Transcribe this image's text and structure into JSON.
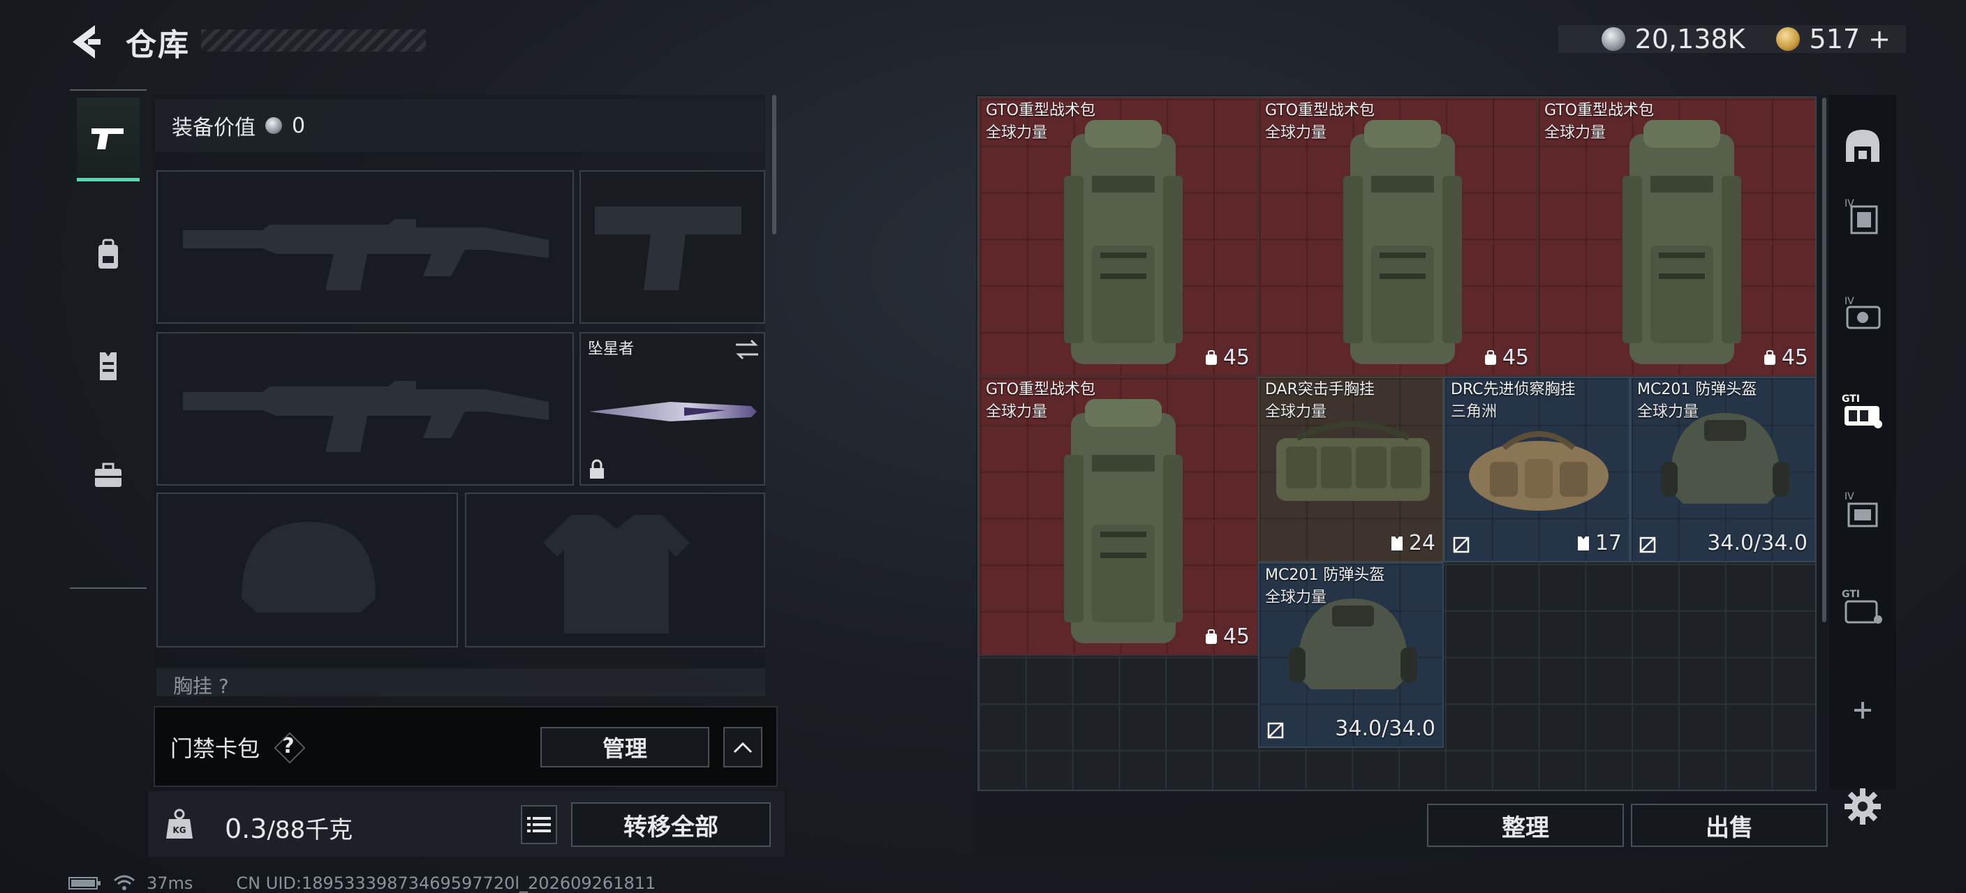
{
  "header": {
    "title": "仓库",
    "currency": [
      {
        "icon": "silver-coin-icon",
        "value": "20,138K"
      },
      {
        "icon": "gold-coin-icon",
        "value": "517 +"
      }
    ]
  },
  "left_rail": [
    {
      "icon": "pistol-icon",
      "active": true
    },
    {
      "icon": "backpack-icon",
      "active": false
    },
    {
      "icon": "vest-icon",
      "active": false
    },
    {
      "icon": "toolbox-icon",
      "active": false
    }
  ],
  "equipment": {
    "value_label": "装备价值",
    "value": "0",
    "melee_name": "坠星者",
    "chest_label": "胸挂 ?"
  },
  "keycard": {
    "label": "门禁卡包",
    "help": "?",
    "manage": "管理"
  },
  "weight": {
    "current": "0.3",
    "max": "/88千克"
  },
  "transfer_all": "转移全部",
  "status": {
    "ping": "37ms",
    "uid": "CN UID:18953339873469597720l_202609261811"
  },
  "storage": {
    "items": [
      {
        "name": "GTO重型战术包",
        "sub": "全球力量",
        "stat": "45",
        "stat_icon": "capacity-icon",
        "color": "red"
      },
      {
        "name": "GTO重型战术包",
        "sub": "全球力量",
        "stat": "45",
        "stat_icon": "capacity-icon",
        "color": "red"
      },
      {
        "name": "GTO重型战术包",
        "sub": "全球力量",
        "stat": "45",
        "stat_icon": "capacity-icon",
        "color": "red"
      },
      {
        "name": "GTO重型战术包",
        "sub": "全球力量",
        "stat": "45",
        "stat_icon": "capacity-icon",
        "color": "red"
      },
      {
        "name": "DAR突击手胸挂",
        "sub": "全球力量",
        "stat": "24",
        "stat_icon": "vest-capacity-icon",
        "color": "brown"
      },
      {
        "name": "DRC先进侦察胸挂",
        "sub": "三角洲",
        "stat": "17",
        "stat_icon": "vest-capacity-icon",
        "color": "blue"
      },
      {
        "name": "MC201 防弹头盔",
        "sub": "全球力量",
        "stat": "34.0/34.0",
        "stat_icon": "durability",
        "color": "blue"
      },
      {
        "name": "MC201 防弹头盔",
        "sub": "全球力量",
        "stat": "34.0/34.0",
        "stat_icon": "durability",
        "color": "blue"
      }
    ],
    "tidy": "整理",
    "sell": "出售"
  },
  "right_rail": [
    "helmet-slot-icon",
    "armor-tier-iv-icon",
    "rig-tier-iv-icon",
    "gti-rig-icon",
    "backpack-tier-iv-icon",
    "gti-backpack-icon",
    "add-icon"
  ]
}
